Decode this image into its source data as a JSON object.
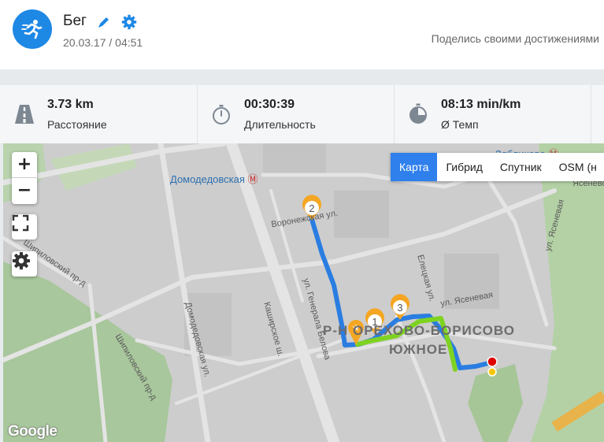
{
  "activity": {
    "title": "Бег",
    "datetime": "20.03.17 / 04:51",
    "share_label": "Поделись своими достижениями"
  },
  "stats": [
    {
      "value": "3.73 km",
      "label": "Расстояние",
      "icon": "road-icon"
    },
    {
      "value": "00:30:39",
      "label": "Длительность",
      "icon": "stopwatch-icon"
    },
    {
      "value": "08:13 min/km",
      "label": "Ø Темп",
      "icon": "pace-icon"
    }
  ],
  "map": {
    "zoom_in": "+",
    "zoom_out": "−",
    "types": [
      "Карта",
      "Гибрид",
      "Спутник",
      "OSM (н"
    ],
    "active_type": "Карта",
    "attribution": "Google",
    "labels": {
      "metro_domodedovskaya": "Домодедовская",
      "metro_zyablikovo": "Зябликово",
      "street_voronezhskaya": "Воронежская ул.",
      "street_kashirskoe": "Каширское ш.",
      "street_domodedovskaya": "Домодедовская ул.",
      "street_shipilovsky_1": "Шипиловский пр-д",
      "street_shipilovsky_2": "Шипиловский пр-д",
      "street_yasenevaya_1": "ул. Ясеневая",
      "street_yasenevaya_2": "ул. Ясеневая",
      "street_eletskaya": "Елецкая ул.",
      "street_belova": "ул. Генерала Белова",
      "district_line1": "Р-Н ОРЕХОВО-БОРИСОВО",
      "district_line2": "ЮЖНОЕ",
      "area_yasenevo": "Ясенево"
    },
    "markers": [
      "1",
      "2",
      "3"
    ],
    "colors": {
      "route_blue": "#2a7de1",
      "route_green": "#7ed321",
      "marker_orange": "#f5a623",
      "accent": "#1e88e5"
    }
  }
}
